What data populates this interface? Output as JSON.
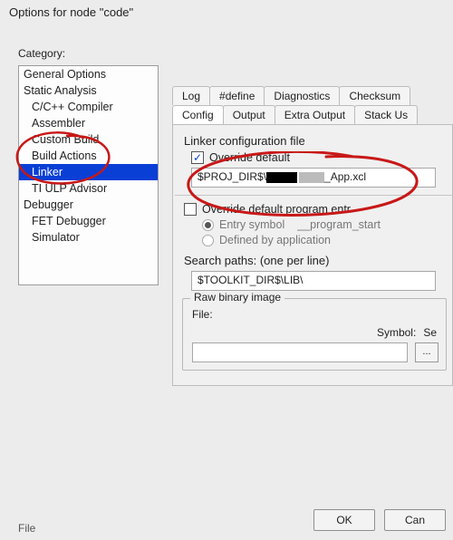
{
  "window": {
    "title": "Options for node \"code\""
  },
  "category": {
    "label": "Category:",
    "items": [
      {
        "label": "General Options",
        "indent": false
      },
      {
        "label": "Static Analysis",
        "indent": false
      },
      {
        "label": "C/C++ Compiler",
        "indent": true
      },
      {
        "label": "Assembler",
        "indent": true
      },
      {
        "label": "Custom Build",
        "indent": true
      },
      {
        "label": "Build Actions",
        "indent": true
      },
      {
        "label": "Linker",
        "indent": true,
        "selected": true
      },
      {
        "label": "TI ULP Advisor",
        "indent": true
      },
      {
        "label": "Debugger",
        "indent": false
      },
      {
        "label": "FET Debugger",
        "indent": true
      },
      {
        "label": "Simulator",
        "indent": true
      }
    ]
  },
  "tabs": {
    "row1": [
      "Log",
      "#define",
      "Diagnostics",
      "Checksum"
    ],
    "row2": [
      "Config",
      "Output",
      "Extra Output",
      "Stack Us"
    ],
    "active": "Config"
  },
  "linker_config": {
    "group": "Linker configuration file",
    "override_label": "Override default",
    "override_checked": true,
    "path_prefix": "$PROJ_DIR$\\",
    "path_suffix": "_App.xcl"
  },
  "program_entry": {
    "override_label": "Override default program entr",
    "override_checked": false,
    "entry_symbol_label": "Entry symbol",
    "entry_symbol_value": "__program_start",
    "defined_label": "Defined by application"
  },
  "search_paths": {
    "label": "Search paths:  (one per line)",
    "value": "$TOOLKIT_DIR$\\LIB\\"
  },
  "raw_binary": {
    "legend": "Raw binary image",
    "file_label": "File:",
    "browse_label": "...",
    "symbol_label": "Symbol:",
    "se_label": "Se"
  },
  "buttons": {
    "ok": "OK",
    "cancel": "Can"
  },
  "footer": {
    "file": "File"
  }
}
